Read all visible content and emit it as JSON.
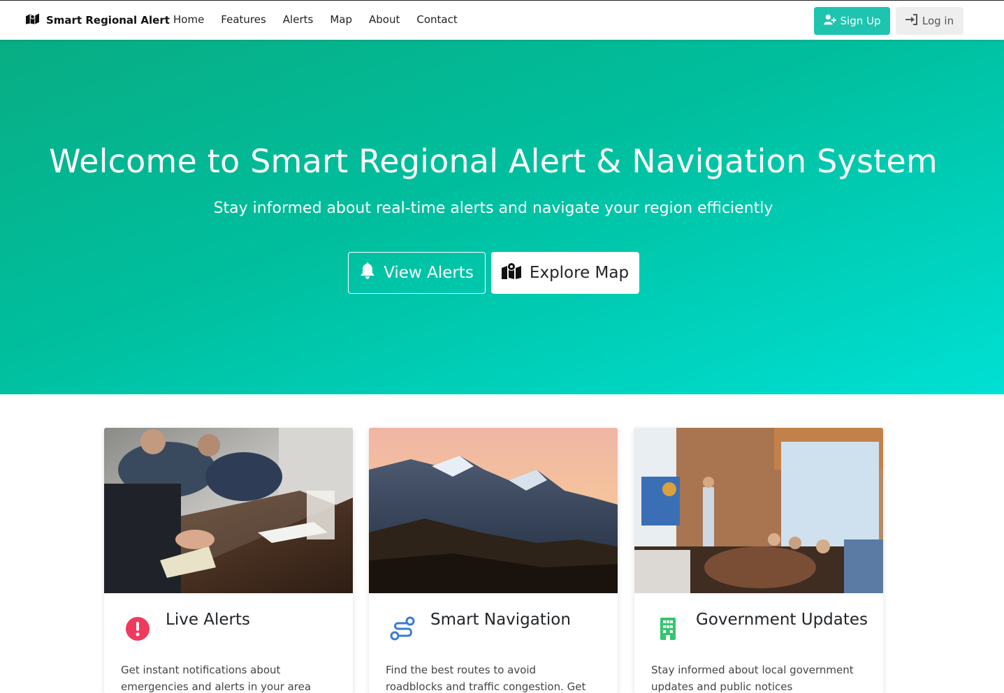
{
  "nav": {
    "brand": "Smart Regional Alert",
    "links": [
      "Home",
      "Features",
      "Alerts",
      "Map",
      "About",
      "Contact"
    ],
    "signup_label": "Sign Up",
    "login_label": "Log in"
  },
  "hero": {
    "title": "Welcome to Smart Regional Alert & Navigation System",
    "subtitle": "Stay informed about real-time alerts and navigate your region efficiently",
    "view_alerts_label": "View Alerts",
    "explore_map_label": "Explore Map"
  },
  "features": [
    {
      "title": "Live Alerts",
      "text": "Get instant notifications about emergencies and alerts in your area",
      "icon": "exclamation-circle-icon"
    },
    {
      "title": "Smart Navigation",
      "text": "Find the best routes to avoid roadblocks and traffic congestion. Get real-time",
      "icon": "route-icon"
    },
    {
      "title": "Government Updates",
      "text": "Stay informed about local government updates and public notices",
      "icon": "building-icon"
    }
  ],
  "colors": {
    "accent": "#1ec4b0",
    "hero_start": "#08ad83",
    "hero_end": "#00e0d4",
    "alert_red": "#ef3a5d",
    "nav_blue": "#3a7bd5",
    "gov_green": "#35c56e"
  }
}
